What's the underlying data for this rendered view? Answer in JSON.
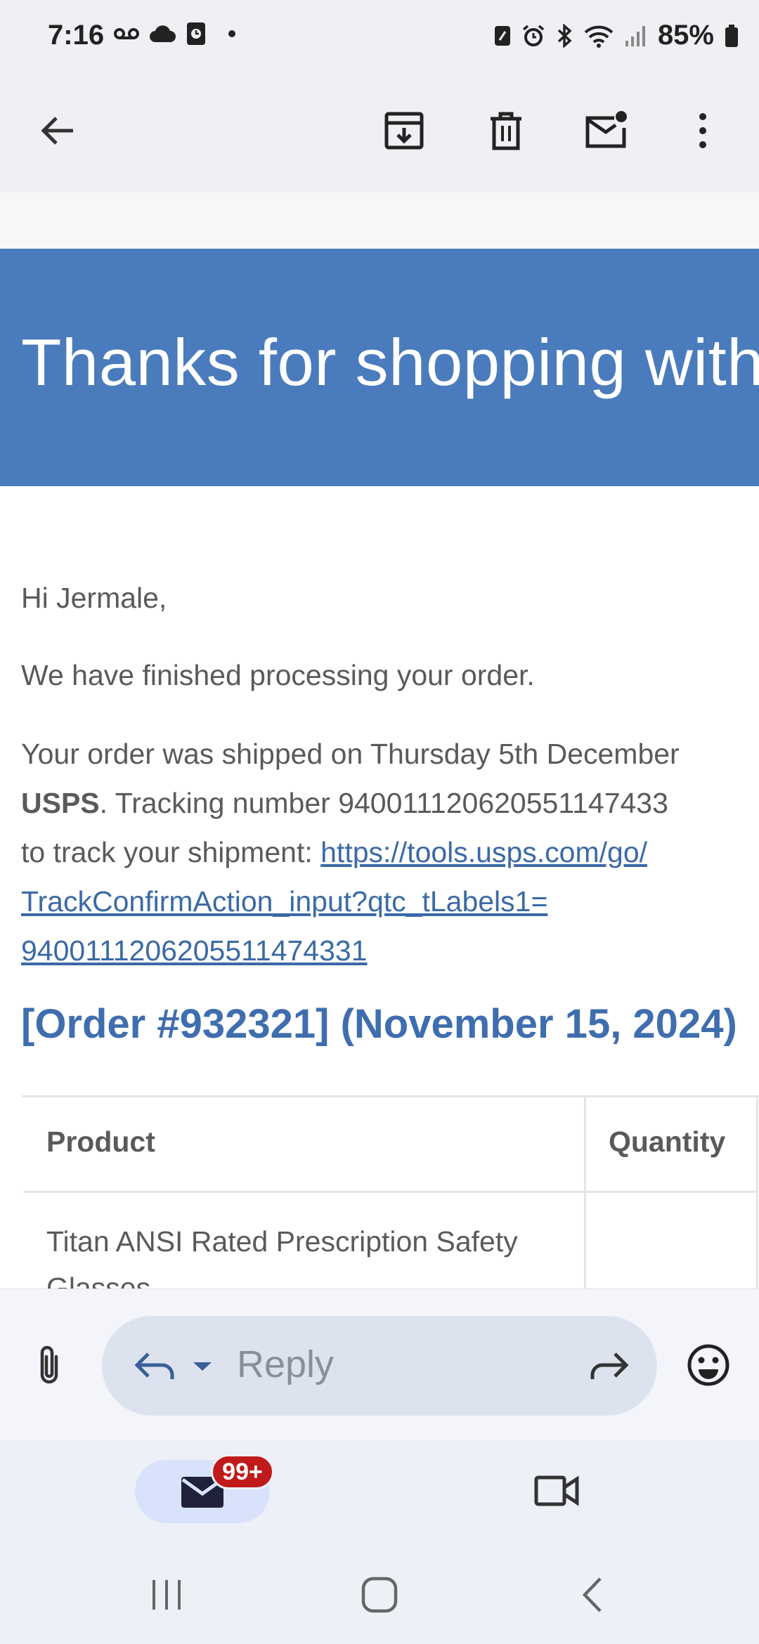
{
  "status_bar": {
    "time": "7:16",
    "battery": "85%",
    "left_icons": [
      "voicemail-icon",
      "cloud-icon",
      "screen-time-icon",
      "dot-icon"
    ],
    "right_icons": [
      "nfc-icon",
      "alarm-icon",
      "bluetooth-icon",
      "wifi-icon",
      "signal-icon",
      "battery-icon"
    ]
  },
  "toolbar": {
    "icons": [
      "back-arrow-icon",
      "archive-icon",
      "trash-icon",
      "mark-unread-icon",
      "more-vert-icon"
    ]
  },
  "email": {
    "banner_title": "Thanks for shopping with",
    "greeting": "Hi Jermale,",
    "processing_line": "We have finished processing your order.",
    "shipped_line": "Your order was shipped on Thursday 5th December",
    "carrier": "USPS",
    "tracking_line": ". Tracking number 940011120620551147433",
    "track_prefix": "to track your shipment: ",
    "link_line1": "https://tools.usps.com/go/",
    "link_line2": "TrackConfirmAction_input?qtc_tLabels1=",
    "link_line3": "9400111206205511474331",
    "order_heading": "[Order #932321] (November 15, 2024)",
    "table": {
      "headers": [
        "Product",
        "Quantity"
      ],
      "rows": [
        {
          "product": "Titan ANSI Rated Prescription Safety Glasses",
          "quantity": ""
        }
      ]
    }
  },
  "reply_bar": {
    "placeholder": "Reply"
  },
  "bottom_nav": {
    "badge": "99+"
  },
  "colors": {
    "banner": "#4a7bbd",
    "link": "#3b6aa6",
    "heading": "#3f6eae",
    "badge": "#c01a1a"
  }
}
